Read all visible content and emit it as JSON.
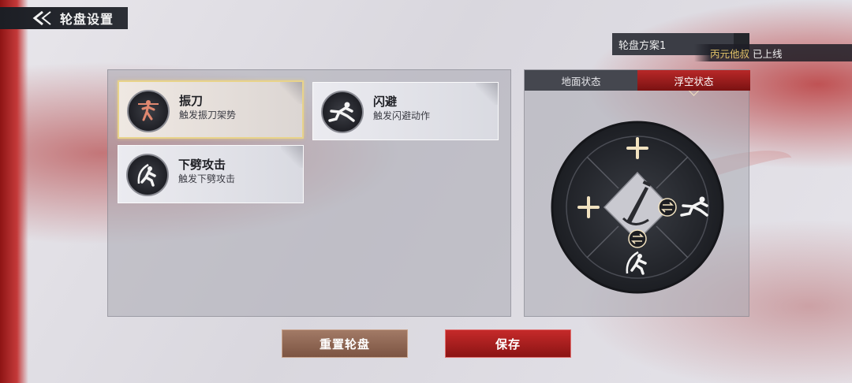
{
  "header": {
    "title": "轮盘设置"
  },
  "scheme": {
    "label": "轮盘方案1"
  },
  "notice": {
    "player_name": "丙元他叔",
    "message": "已上线"
  },
  "skills": [
    {
      "name": "振刀",
      "desc": "触发振刀架势",
      "icon": "parry-stance-icon",
      "selected": true
    },
    {
      "name": "闪避",
      "desc": "触发闪避动作",
      "icon": "dash-dodge-icon",
      "selected": false
    },
    {
      "name": "下劈攻击",
      "desc": "触发下劈攻击",
      "icon": "downward-slash-icon",
      "selected": false
    }
  ],
  "wheel": {
    "tabs": [
      {
        "label": "地面状态",
        "active": false
      },
      {
        "label": "浮空状态",
        "active": true
      }
    ],
    "slots": [
      "add-slot-icon",
      "add-slot-icon",
      "dash-dodge-icon",
      "downward-slash-icon"
    ],
    "center_icon": "sword-icon"
  },
  "buttons": {
    "reset": "重置轮盘",
    "save": "保存"
  },
  "colors": {
    "accent_red": "#b82828",
    "gold": "#e6c46a",
    "dark": "#1f2026"
  }
}
